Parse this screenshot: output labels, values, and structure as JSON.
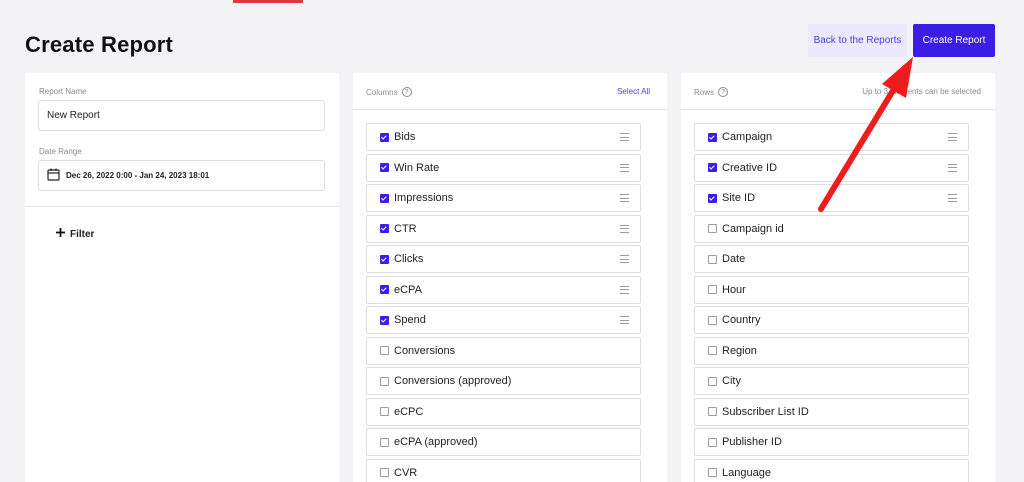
{
  "header": {
    "title": "Create Report",
    "back_label": "Back to the Reports",
    "create_label": "Create Report"
  },
  "left_panel": {
    "report_name_label": "Report Name",
    "report_name_value": "New Report",
    "date_range_label": "Date Range",
    "date_range_value": "Dec 26, 2022 0:00 - Jan 24, 2023 18:01",
    "filter_label": "Filter"
  },
  "columns_panel": {
    "title": "Columns",
    "select_all": "Select All",
    "items": [
      {
        "label": "Bids",
        "checked": true
      },
      {
        "label": "Win Rate",
        "checked": true
      },
      {
        "label": "Impressions",
        "checked": true
      },
      {
        "label": "CTR",
        "checked": true
      },
      {
        "label": "Clicks",
        "checked": true
      },
      {
        "label": "eCPA",
        "checked": true
      },
      {
        "label": "Spend",
        "checked": true
      },
      {
        "label": "Conversions",
        "checked": false
      },
      {
        "label": "Conversions (approved)",
        "checked": false
      },
      {
        "label": "eCPC",
        "checked": false
      },
      {
        "label": "eCPA (approved)",
        "checked": false
      },
      {
        "label": "CVR",
        "checked": false
      }
    ]
  },
  "rows_panel": {
    "title": "Rows",
    "note": "Up to 3 elements can be selected",
    "items": [
      {
        "label": "Campaign",
        "checked": true
      },
      {
        "label": "Creative ID",
        "checked": true
      },
      {
        "label": "Site ID",
        "checked": true
      },
      {
        "label": "Campaign id",
        "checked": false
      },
      {
        "label": "Date",
        "checked": false
      },
      {
        "label": "Hour",
        "checked": false
      },
      {
        "label": "Country",
        "checked": false
      },
      {
        "label": "Region",
        "checked": false
      },
      {
        "label": "City",
        "checked": false
      },
      {
        "label": "Subscriber List ID",
        "checked": false
      },
      {
        "label": "Publisher ID",
        "checked": false
      },
      {
        "label": "Language",
        "checked": false
      }
    ]
  },
  "colors": {
    "accent": "#3a1ee6",
    "annotation_arrow": "#ee1c1c"
  }
}
